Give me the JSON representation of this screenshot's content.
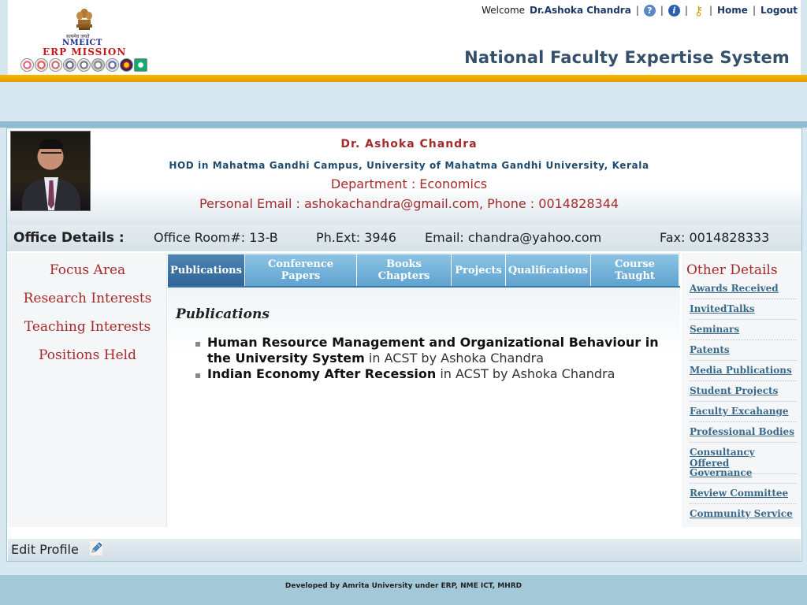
{
  "header": {
    "logo": {
      "motto": "सत्यमेव जयते",
      "line1": "NMEICT",
      "line2": "ERP MISSION"
    },
    "welcome": "Welcome",
    "user_name": "Dr.Ashoka Chandra",
    "sep": "|",
    "home_label": "Home",
    "logout_label": "Logout",
    "help_icon": "?",
    "info_icon": "i",
    "key_icon": "⚷",
    "system_title": "National Faculty Expertise System"
  },
  "profile": {
    "name": "Dr. Ashoka Chandra",
    "designation": "HOD in Mahatma Gandhi Campus, University of Mahatma Gandhi University, Kerala",
    "department": "Department : Economics",
    "contact": "Personal Email : ashokachandra@gmail.com, Phone : 0014828344"
  },
  "office": {
    "label": "Office Details :",
    "room": "Office Room#: 13-B",
    "ext": "Ph.Ext: 3946",
    "email": "Email: chandra@yahoo.com",
    "fax": "Fax: 0014828333"
  },
  "left_menu": [
    "Focus Area",
    "Research Interests",
    "Teaching Interests",
    "Positions Held"
  ],
  "tabs": [
    {
      "label": "Publications",
      "active": true
    },
    {
      "label": "Conference Papers",
      "active": false
    },
    {
      "label": "Books Chapters",
      "active": false
    },
    {
      "label": "Projects",
      "active": false
    },
    {
      "label": "Qualifications",
      "active": false
    },
    {
      "label": "Course Taught",
      "active": false
    }
  ],
  "publications": {
    "heading": "Publications",
    "items": [
      {
        "title": "Human Resource Management and Organizational Behaviour in the University System",
        "detail": " in ACST by Ashoka Chandra"
      },
      {
        "title": "Indian Economy After Recession",
        "detail": " in ACST by Ashoka Chandra"
      }
    ]
  },
  "right_menu": {
    "title": "Other Details",
    "links": [
      "Awards Received",
      "InvitedTalks",
      "Seminars",
      "Patents",
      "Media Publications",
      "Student Projects",
      "Faculty Excahange",
      "Professional Bodies",
      "Consultancy Offered",
      "Governance",
      "Review Committee",
      "Community Service"
    ]
  },
  "edit_profile": {
    "label": "Edit Profile"
  },
  "footer": {
    "text": "Developed by Amrita University under ERP, NME ICT, MHRD"
  }
}
